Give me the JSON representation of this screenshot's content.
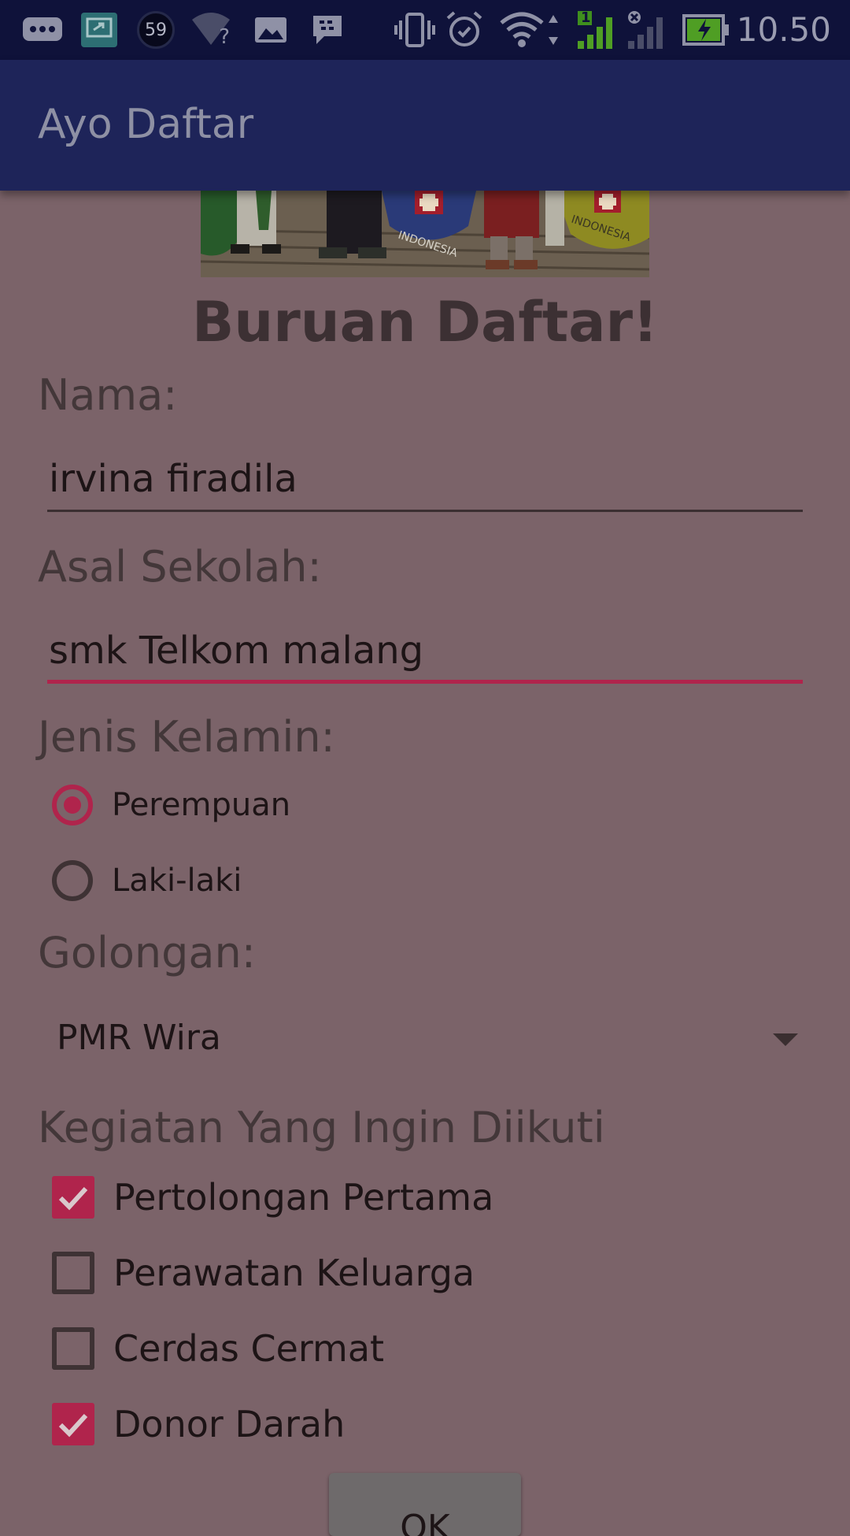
{
  "status_bar": {
    "time": "10.50",
    "notification_count": "59",
    "wifi_unknown": "?",
    "sim_label": "1"
  },
  "app_bar": {
    "title": "Ayo Daftar"
  },
  "banner": {
    "badge_text": "INDONESIA"
  },
  "form": {
    "heading": "Buruan Daftar!",
    "name_label": "Nama:",
    "name_value": "irvina firadila",
    "school_label": "Asal Sekolah:",
    "school_value": "smk Telkom malang",
    "gender_label": "Jenis Kelamin:",
    "gender_options": [
      {
        "label": "Perempuan",
        "selected": true
      },
      {
        "label": "Laki-laki",
        "selected": false
      }
    ],
    "group_label": "Golongan:",
    "group_value": "PMR Wira",
    "activities_label": "Kegiatan Yang Ingin Diikuti",
    "activities": [
      {
        "label": "Pertolongan Pertama",
        "checked": true
      },
      {
        "label": "Perawatan Keluarga",
        "checked": false
      },
      {
        "label": "Cerdas Cermat",
        "checked": false
      },
      {
        "label": "Donor Darah",
        "checked": true
      }
    ],
    "ok_label": "OK"
  },
  "colors": {
    "accent": "#b0244c",
    "app_bar": "#1e2459",
    "status_bar": "#0f123a",
    "scrim_background": "#7b6369"
  }
}
